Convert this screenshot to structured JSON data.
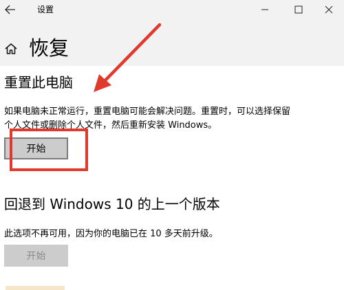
{
  "window": {
    "title": "设置",
    "back_icon": "arrow-left-icon",
    "minimize_icon": "minimize-icon",
    "maximize_icon": "maximize-icon",
    "close_icon": "close-icon"
  },
  "page": {
    "title": "恢复",
    "home_icon": "home-icon"
  },
  "reset_section": {
    "title": "重置此电脑",
    "description_line1": "如果电脑未正常运行，重置电脑可能会解决问题。重置时，可以选择保留",
    "description_line2": "个人文件或删除个人文件，然后重新安装 Windows。",
    "button_label": "开始"
  },
  "rollback_section": {
    "title": "回退到 Windows 10 的上一个版本",
    "description": "此选项不再可用，因为你的电脑已在 10 多天前升级。",
    "button_label": "开始"
  },
  "annotation": {
    "color": "#e03a2f"
  }
}
